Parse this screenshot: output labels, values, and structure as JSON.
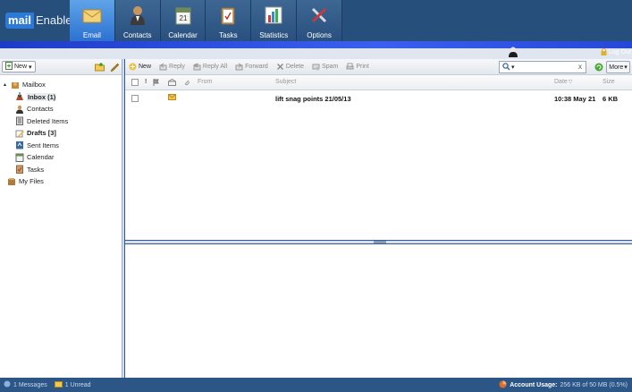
{
  "app": {
    "logo_part1": "mail",
    "logo_part2": "Enable"
  },
  "nav": {
    "tabs": [
      {
        "label": "Email",
        "icon": "envelope-icon",
        "active": true
      },
      {
        "label": "Contacts",
        "icon": "person-icon",
        "active": false
      },
      {
        "label": "Calendar",
        "icon": "calendar-icon",
        "active": false
      },
      {
        "label": "Tasks",
        "icon": "clipboard-icon",
        "active": false
      },
      {
        "label": "Statistics",
        "icon": "bar-chart-icon",
        "active": false
      },
      {
        "label": "Options",
        "icon": "tools-icon",
        "active": false
      }
    ]
  },
  "header": {
    "logout_label": "Log Out"
  },
  "sidebar": {
    "new_label": "New",
    "root_label": "Mailbox",
    "items": [
      {
        "label": "Inbox (1)",
        "icon": "inbox-icon",
        "bold": true,
        "selected": true
      },
      {
        "label": "Contacts",
        "icon": "contacts-icon",
        "bold": false
      },
      {
        "label": "Deleted Items",
        "icon": "trash-icon",
        "bold": false
      },
      {
        "label": "Drafts [3]",
        "icon": "drafts-icon",
        "bold": true
      },
      {
        "label": "Sent Items",
        "icon": "sent-icon",
        "bold": false
      },
      {
        "label": "Calendar",
        "icon": "calendar-icon",
        "bold": false
      },
      {
        "label": "Tasks",
        "icon": "tasks-icon",
        "bold": false
      }
    ],
    "files_label": "My Files"
  },
  "toolbar": {
    "new_label": "New",
    "reply_label": "Reply",
    "reply_all_label": "Reply All",
    "forward_label": "Forward",
    "delete_label": "Delete",
    "spam_label": "Spam",
    "print_label": "Print",
    "clear_label": "x",
    "more_label": "More"
  },
  "columns": {
    "from": "From",
    "subject": "Subject",
    "date": "Date",
    "size": "Size"
  },
  "messages": [
    {
      "subject": "lift snag points 21/05/13",
      "date": "10:38 May 21",
      "size": "6 KB",
      "unread": true
    }
  ],
  "status": {
    "messages": "1 Messages",
    "unread": "1 Unread",
    "usage_label": "Account Usage:",
    "usage_value": "256 KB of 50 MB (0.5%)"
  },
  "colors": {
    "header": "#274f7c",
    "active_tab": "#2a6fd0",
    "accent": "#1c3cc8",
    "statusbar": "#2b5686"
  }
}
